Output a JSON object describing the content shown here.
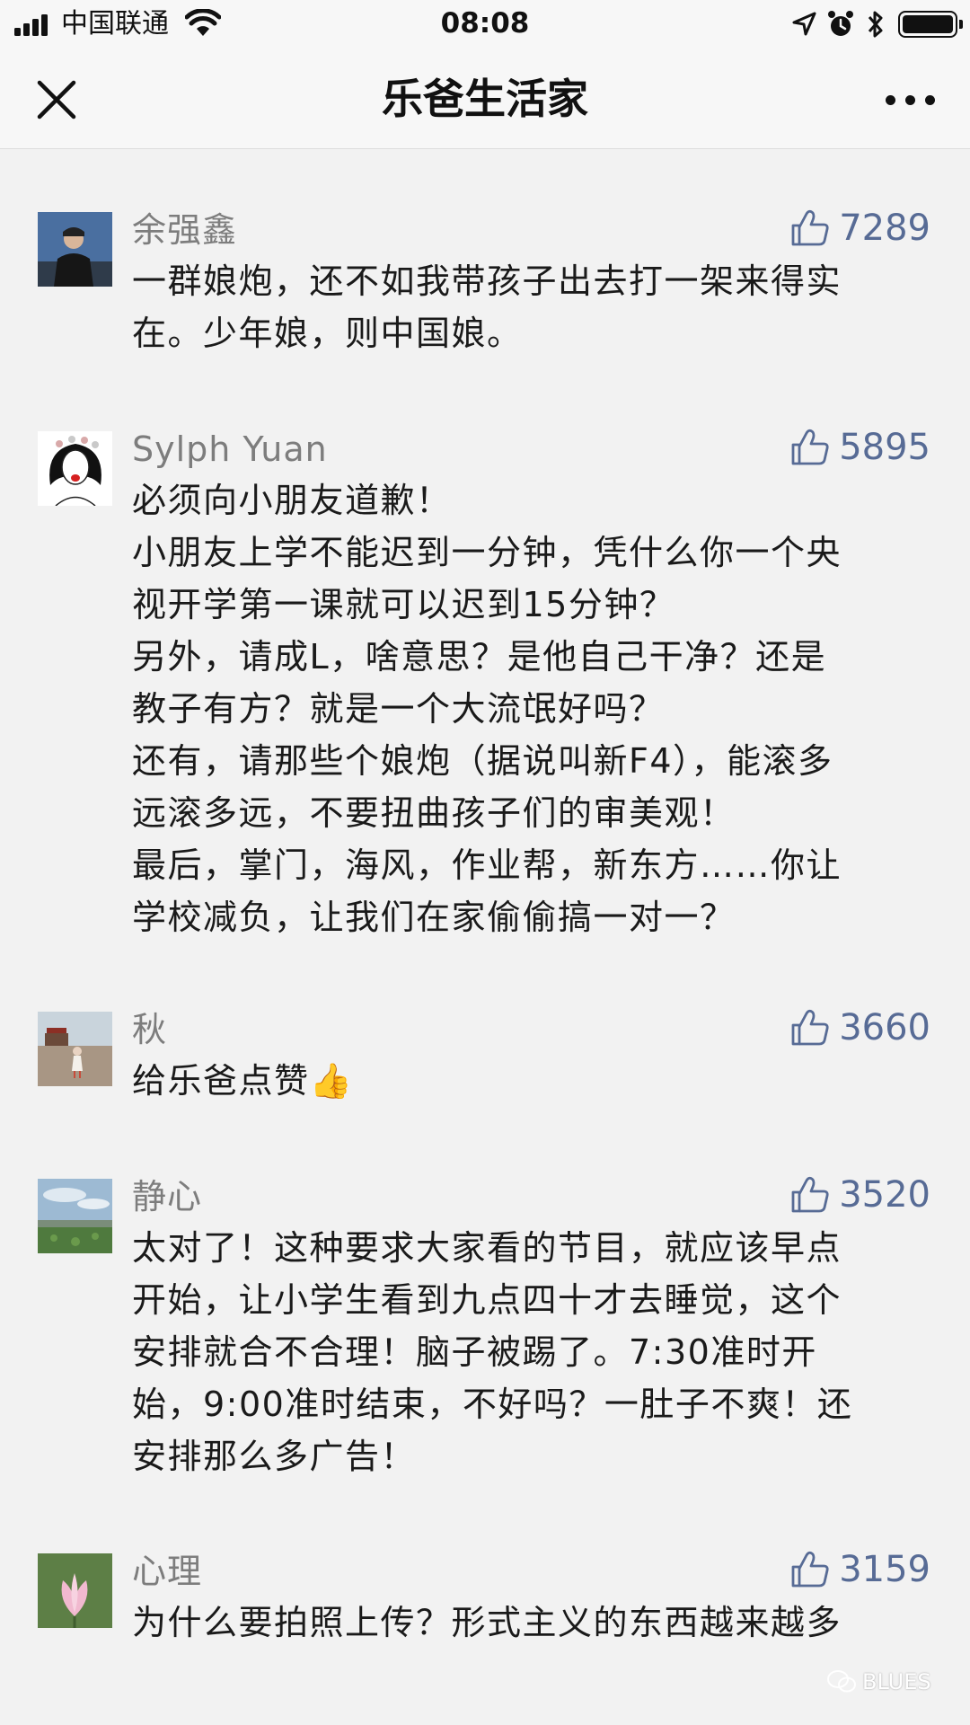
{
  "status_bar": {
    "carrier": "中国联通",
    "time": "08:08",
    "icons": [
      "signal-icon",
      "wifi-icon",
      "location-icon",
      "alarm-icon",
      "bluetooth-icon",
      "battery-icon"
    ]
  },
  "header": {
    "title": "乐爸生活家",
    "close_icon": "close-icon",
    "more_icon": "more-icon"
  },
  "comments": [
    {
      "nickname": "余强鑫",
      "likes": "7289",
      "text": "一群娘炮，还不如我带孩子出去打一架来得实\n在。少年娘，则中国娘。"
    },
    {
      "nickname": "Sylph Yuan",
      "likes": "5895",
      "text": "必须向小朋友道歉！\n小朋友上学不能迟到一分钟，凭什么你一个央\n视开学第一课就可以迟到15分钟？\n另外，请成L，啥意思？是他自己干净？还是\n教子有方？就是一个大流氓好吗？\n还有，请那些个娘炮（据说叫新F4），能滚多\n远滚多远，不要扭曲孩子们的审美观！\n最后，掌门，海风，作业帮，新东方……你让\n学校减负，让我们在家偷偷搞一对一？"
    },
    {
      "nickname": "秋",
      "likes": "3660",
      "text": "给乐爸点赞👍"
    },
    {
      "nickname": "静心",
      "likes": "3520",
      "text": "太对了！这种要求大家看的节目，就应该早点\n开始，让小学生看到九点四十才去睡觉，这个\n安排就合不合理！脑子被踢了。7:30准时开\n始，9:00准时结束，不好吗？一肚子不爽！还\n安排那么多广告！"
    },
    {
      "nickname": "心理",
      "likes": "3159",
      "text": "为什么要拍照上传？形式主义的东西越来越多"
    }
  ],
  "watermark": "BLUES",
  "colors": {
    "link": "#576b95",
    "nickname": "#7d7d7d",
    "background": "#f2f2f2",
    "header": "#f7f7f7"
  }
}
